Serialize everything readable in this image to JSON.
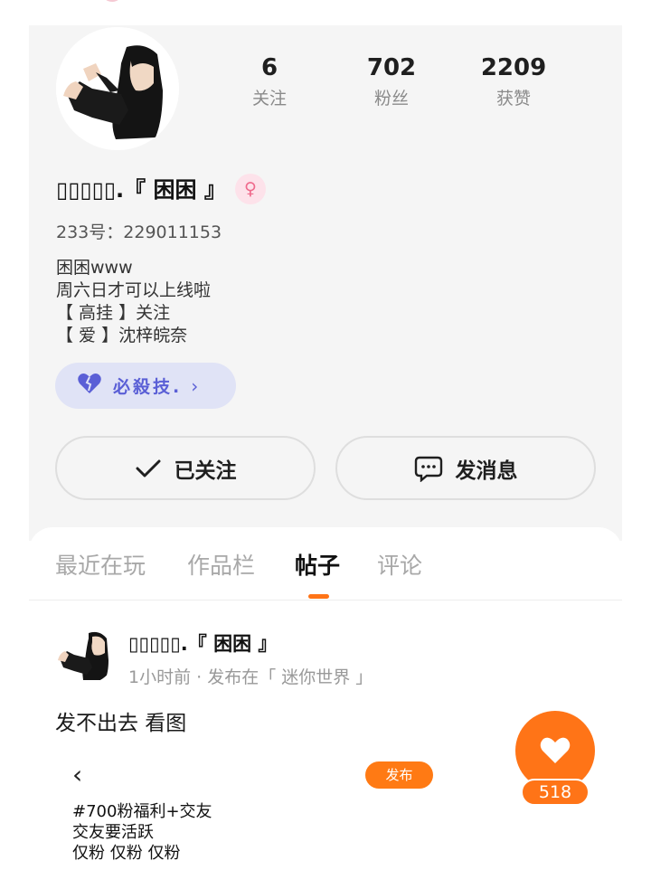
{
  "profile": {
    "stats": [
      {
        "value": "6",
        "label": "关注"
      },
      {
        "value": "702",
        "label": "粉丝"
      },
      {
        "value": "2209",
        "label": "获赞"
      }
    ],
    "username": "▯▯▯▯▯.『 困困 』",
    "gender_symbol": "♀",
    "uid_text": "233号：229011153",
    "bio_lines": [
      "困困www",
      "周六日才可以上线啦",
      "【 高挂 】关注",
      "【 爱 】沈梓皖奈"
    ],
    "skill_chip": {
      "label": "必殺技.",
      "arrow": "›"
    },
    "follow_button": "已关注",
    "message_button": "发消息"
  },
  "tabs": [
    {
      "label": "最近在玩"
    },
    {
      "label": "作品栏"
    },
    {
      "label": "帖子",
      "active": true
    },
    {
      "label": "评论"
    }
  ],
  "post": {
    "author": "▯▯▯▯▯.『 困困 』",
    "meta": "1小时前 · 发布在「 迷你世界 」",
    "text": "发不出去 看图",
    "image": {
      "back_glyph": "‹",
      "publish_label": "发布",
      "lines": [
        "#700粉福利+交友",
        "交友要活跃",
        "仅粉 仅粉 仅粉"
      ]
    },
    "like_count": "518"
  },
  "colors": {
    "accent": "#ff7417",
    "skill": "#5a5fd6",
    "gender": "#ef6a8c"
  }
}
